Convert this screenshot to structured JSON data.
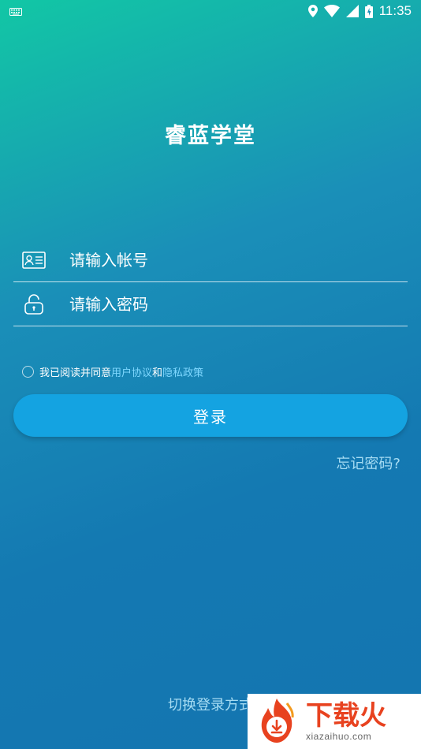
{
  "status_bar": {
    "time": "11:35",
    "icons": [
      "keyboard-icon",
      "location-icon",
      "wifi-icon",
      "signal-icon",
      "battery-icon"
    ]
  },
  "app": {
    "title": "睿蓝学堂"
  },
  "form": {
    "account_placeholder": "请输入帐号",
    "password_placeholder": "请输入密码",
    "account_icon": "id-card-icon",
    "password_icon": "lock-icon"
  },
  "agreement": {
    "prefix": "我已阅读并同意",
    "user_agreement": "用户协议",
    "and": "和",
    "privacy_policy": "隐私政策",
    "checked": false
  },
  "actions": {
    "login": "登录",
    "forgot_password": "忘记密码?",
    "switch_login": "切换登录方式"
  },
  "watermark": {
    "name": "下载火",
    "url": "xiazaihuo.com"
  },
  "colors": {
    "gradient_top": "#12c7a5",
    "gradient_bottom": "#1475b0",
    "button": "#14a3e1",
    "link": "#7fd8ff",
    "watermark_red": "#e8421f"
  }
}
